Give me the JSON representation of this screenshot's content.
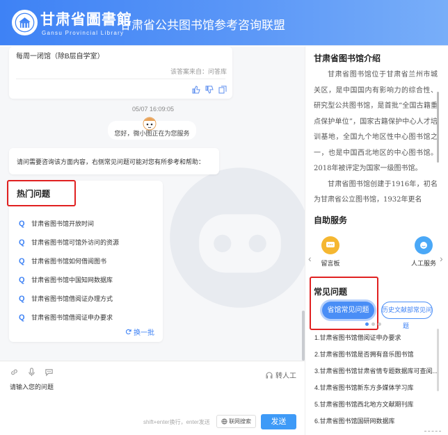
{
  "header": {
    "logo_cn": "甘肃省圖書館",
    "logo_en": "Gansu Provincial Library",
    "title": "甘肃省公共图书馆参考咨询联盟"
  },
  "chat": {
    "prev_answer": {
      "text": "每周一闭馆（除B层自学室）",
      "source": "该答案来自：问答库"
    },
    "timestamp": "05/07 16:09:05",
    "greeting": "您好，微小图正在为您服务",
    "prompt": "请问需要咨询该方面内容，右侧常见问题可能对您有所参考和帮助：",
    "hot": {
      "title": "热门问题",
      "q_mark": "Q",
      "items": [
        "甘肃省图书馆开放时间",
        "甘肃省图书馆可馆外访问的资源",
        "甘肃省图书馆如何借阅图书",
        "甘肃省图书馆中国知网数据库",
        "甘肃省图书馆借阅证办理方式",
        "甘肃省图书馆借阅证申办要求"
      ],
      "refresh": "换一批"
    }
  },
  "input": {
    "human": "转人工",
    "placeholder": "请输入您的问题",
    "hint": "shift+enter换行，enter发送",
    "search": "联网搜索",
    "send": "发送"
  },
  "right": {
    "intro_title": "甘肃省图书馆介绍",
    "intro_p1": "甘肃省图书馆位于甘肃省兰州市城关区，是中国国内有影响力的综合性、研究型公共图书馆，是首批“全国古籍重点保护单位”，国家古籍保护中心人才培训基地，全国九个地区性中心图书馆之一，也是中国西北地区的中心图书馆。2018年被评定为国家一级图书馆。",
    "intro_p2": "甘肃省图书馆创建于1916年，初名为甘肃省公立图书馆，1932年更名",
    "service_title": "自助服务",
    "services": [
      "留言板",
      "人工服务"
    ],
    "faq_title": "常见问题",
    "faq_tabs": [
      "省馆常见问题",
      "历史文献部常见问"
    ],
    "faq_tab2_tail": "题",
    "faq_items": [
      "1.甘肃省图书馆借阅证申办要求",
      "2.甘肃省图书馆是否拥有音乐图书馆",
      "3.甘肃省图书馆甘肃省情专题数据库可查阅...",
      "4.甘肃省图书馆新东方多媒体学习库",
      "5.甘肃省图书馆西北地方文献期刊库",
      "6.甘肃省图书馆国研网数据库"
    ]
  },
  "colors": {
    "brand": "#3e82f5",
    "highlight_box": "#e02020",
    "send": "#3e9af7"
  }
}
